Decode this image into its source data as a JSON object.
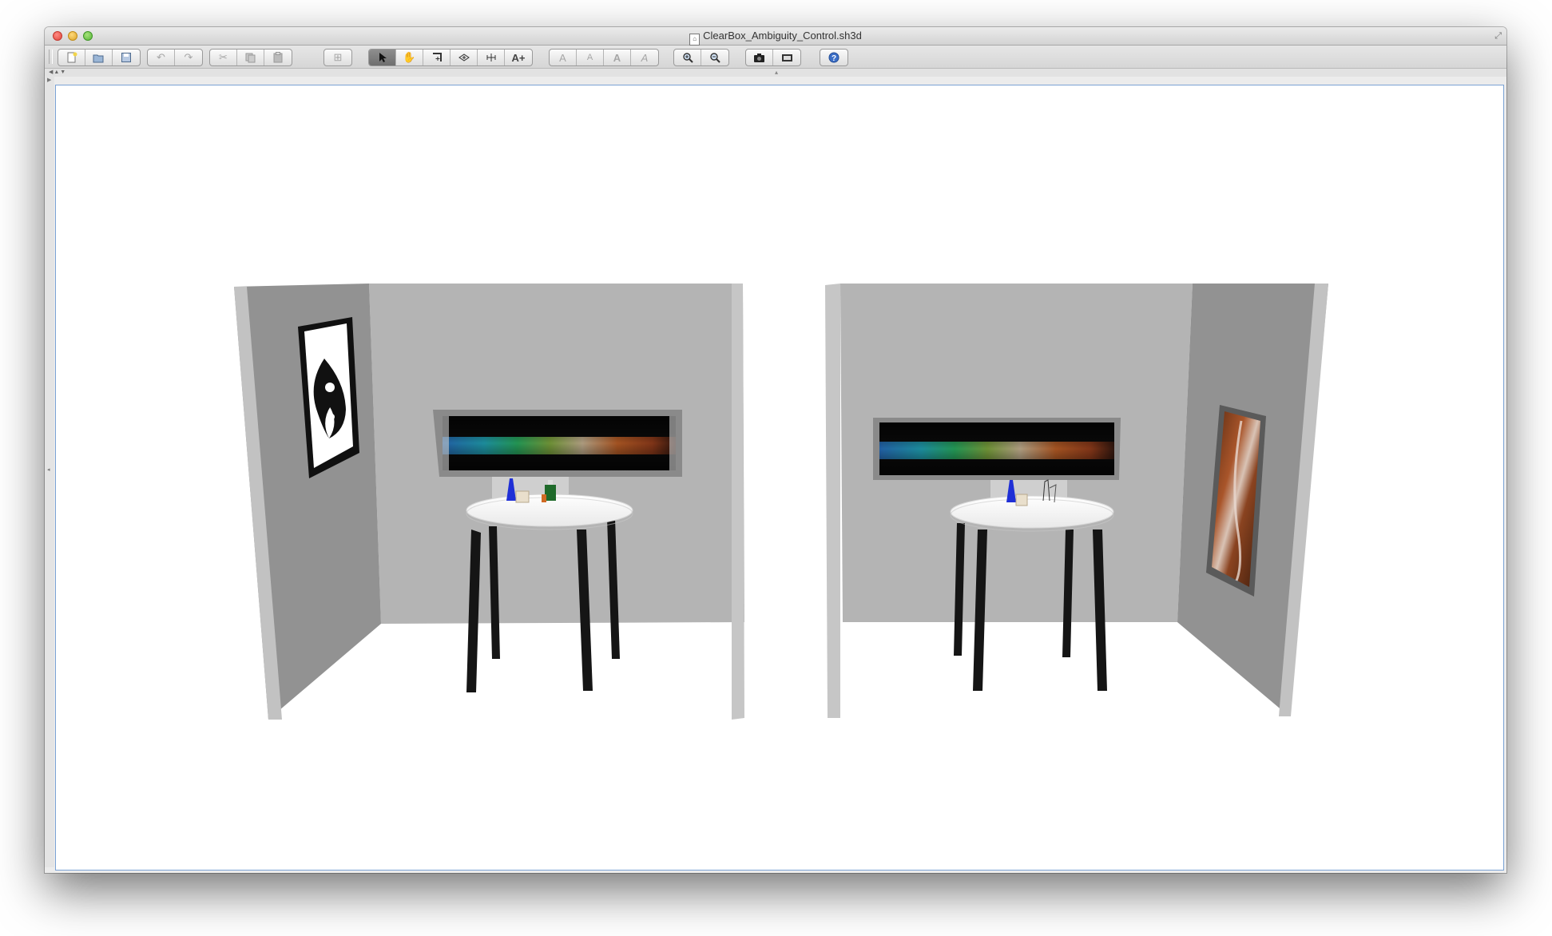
{
  "window": {
    "title": "ClearBox_Ambiguity_Control.sh3d"
  },
  "toolbar": {
    "groups": [
      {
        "buttons": [
          {
            "icon": "new-home-icon"
          },
          {
            "icon": "open-icon"
          },
          {
            "icon": "save-icon"
          }
        ]
      },
      {
        "buttons": [
          {
            "icon": "undo-icon",
            "dim": true
          },
          {
            "icon": "redo-icon",
            "dim": true
          }
        ]
      },
      {
        "buttons": [
          {
            "icon": "cut-icon",
            "dim": true
          },
          {
            "icon": "copy-icon",
            "dim": true
          },
          {
            "icon": "paste-icon",
            "dim": true
          }
        ]
      },
      {
        "buttons": [
          {
            "icon": "add-furniture-icon",
            "dim": true
          }
        ]
      },
      {
        "buttons": [
          {
            "icon": "select-pointer-icon",
            "selected": true
          },
          {
            "icon": "pan-hand-icon"
          },
          {
            "icon": "create-walls-icon"
          },
          {
            "icon": "create-rooms-icon"
          },
          {
            "icon": "create-dimensions-icon"
          },
          {
            "icon": "add-text-icon"
          }
        ]
      },
      {
        "buttons": [
          {
            "icon": "increase-text-size-icon",
            "dim": true
          },
          {
            "icon": "decrease-text-size-icon",
            "dim": true
          },
          {
            "icon": "bold-text-icon",
            "dim": true
          },
          {
            "icon": "italic-text-icon",
            "dim": true
          }
        ]
      },
      {
        "buttons": [
          {
            "icon": "zoom-in-icon"
          },
          {
            "icon": "zoom-out-icon"
          }
        ]
      },
      {
        "buttons": [
          {
            "icon": "create-photo-icon"
          },
          {
            "icon": "create-video-icon"
          }
        ]
      },
      {
        "buttons": [
          {
            "icon": "help-icon"
          }
        ]
      }
    ]
  },
  "scene": {
    "left_room": {
      "side_wall_artwork": "yin-yang-poster",
      "back_wall_artwork": "spectrum-panel",
      "table_items": [
        "blue-bottle",
        "paper-box",
        "green-bottle"
      ]
    },
    "right_room": {
      "side_wall_artwork": "abstract-brown-poster",
      "back_wall_artwork": "spectrum-panel",
      "table_items": [
        "blue-bottle",
        "paper-box",
        "glass-lamp"
      ]
    },
    "colors": {
      "floor": "#ffffff",
      "back_wall": "#b3b3b3",
      "side_wall": "#929292",
      "wall_edge": "#c4c4c4",
      "table_top": "#ffffff",
      "table_legs": "#141414",
      "selection_border": "#7aa2d4"
    }
  }
}
